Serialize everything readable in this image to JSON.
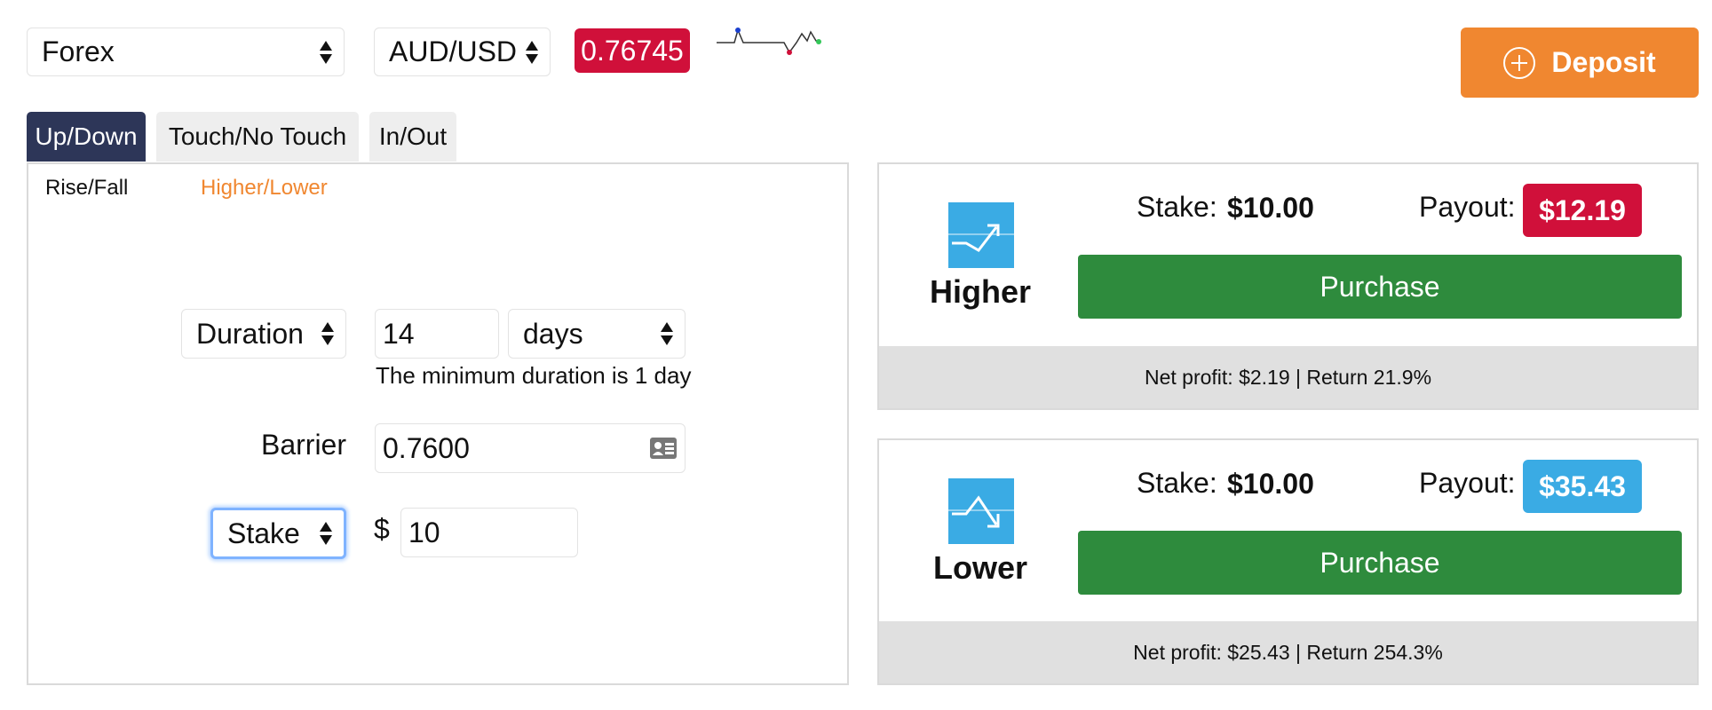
{
  "top": {
    "market": "Forex",
    "symbol": "AUD/USD",
    "price": "0.76745",
    "deposit_label": "Deposit",
    "price_badge_color": "#d0103a",
    "deposit_color": "#f08730"
  },
  "tabs": [
    {
      "label": "Up/Down",
      "active": true
    },
    {
      "label": "Touch/No Touch",
      "active": false
    },
    {
      "label": "In/Out",
      "active": false
    }
  ],
  "subtabs": [
    {
      "label": "Rise/Fall",
      "active": false
    },
    {
      "label": "Higher/Lower",
      "active": true
    }
  ],
  "form": {
    "duration_select": "Duration",
    "duration_value": "14",
    "duration_unit": "days",
    "duration_hint": "The minimum duration is 1 day",
    "barrier_label": "Barrier",
    "barrier_value": "0.7600",
    "amount_type": "Stake",
    "currency_symbol": "$",
    "amount_value": "10"
  },
  "contracts": [
    {
      "name": "Higher",
      "stake_label": "Stake:",
      "stake_value": "$10.00",
      "payout_label": "Payout:",
      "payout_value": "$12.19",
      "payout_color": "#d0103a",
      "button_label": "Purchase",
      "footer": "Net profit: $2.19 | Return 21.9%",
      "icon": "trend-up-icon"
    },
    {
      "name": "Lower",
      "stake_label": "Stake:",
      "stake_value": "$10.00",
      "payout_label": "Payout:",
      "payout_value": "$35.43",
      "payout_color": "#3aabe4",
      "button_label": "Purchase",
      "footer": "Net profit: $25.43 | Return 254.3%",
      "icon": "trend-down-icon"
    }
  ]
}
